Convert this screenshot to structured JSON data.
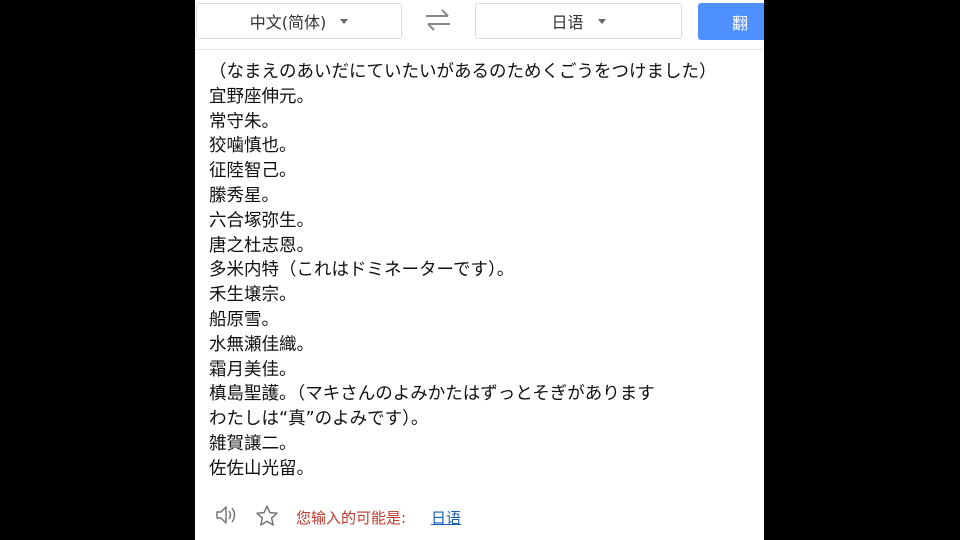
{
  "lang_bar": {
    "source_lang": "中文(简体)",
    "target_lang": "日语",
    "translate_label": "翻"
  },
  "source_text": {
    "lines": [
      "（なまえのあいだにていたいがあるのためくごうをつけました）",
      "宜野座伸元。",
      "常守朱。",
      "狡噛慎也。",
      "征陸智己。",
      "縢秀星。",
      "六合塚弥生。",
      "唐之杜志恩。",
      "多米内特（これはドミネーターです）。",
      "禾生壌宗。",
      "船原雪。",
      "水無瀬佳織。",
      "霜月美佳。",
      "槙島聖護。（マキさんのよみかたはずっとそぎがあります",
      "わたしは“真”のよみです）。",
      "雑賀譲二。",
      "佐佐山光留。"
    ]
  },
  "footer": {
    "detect_label": "您输入的可能是:",
    "detected_lang": "日语"
  },
  "colors": {
    "accent": "#4d90fe",
    "detect_label": "#c0392b",
    "link": "#1a5fb4"
  },
  "icons": [
    "caret-down-icon",
    "swap-icon",
    "speaker-icon",
    "star-icon"
  ]
}
